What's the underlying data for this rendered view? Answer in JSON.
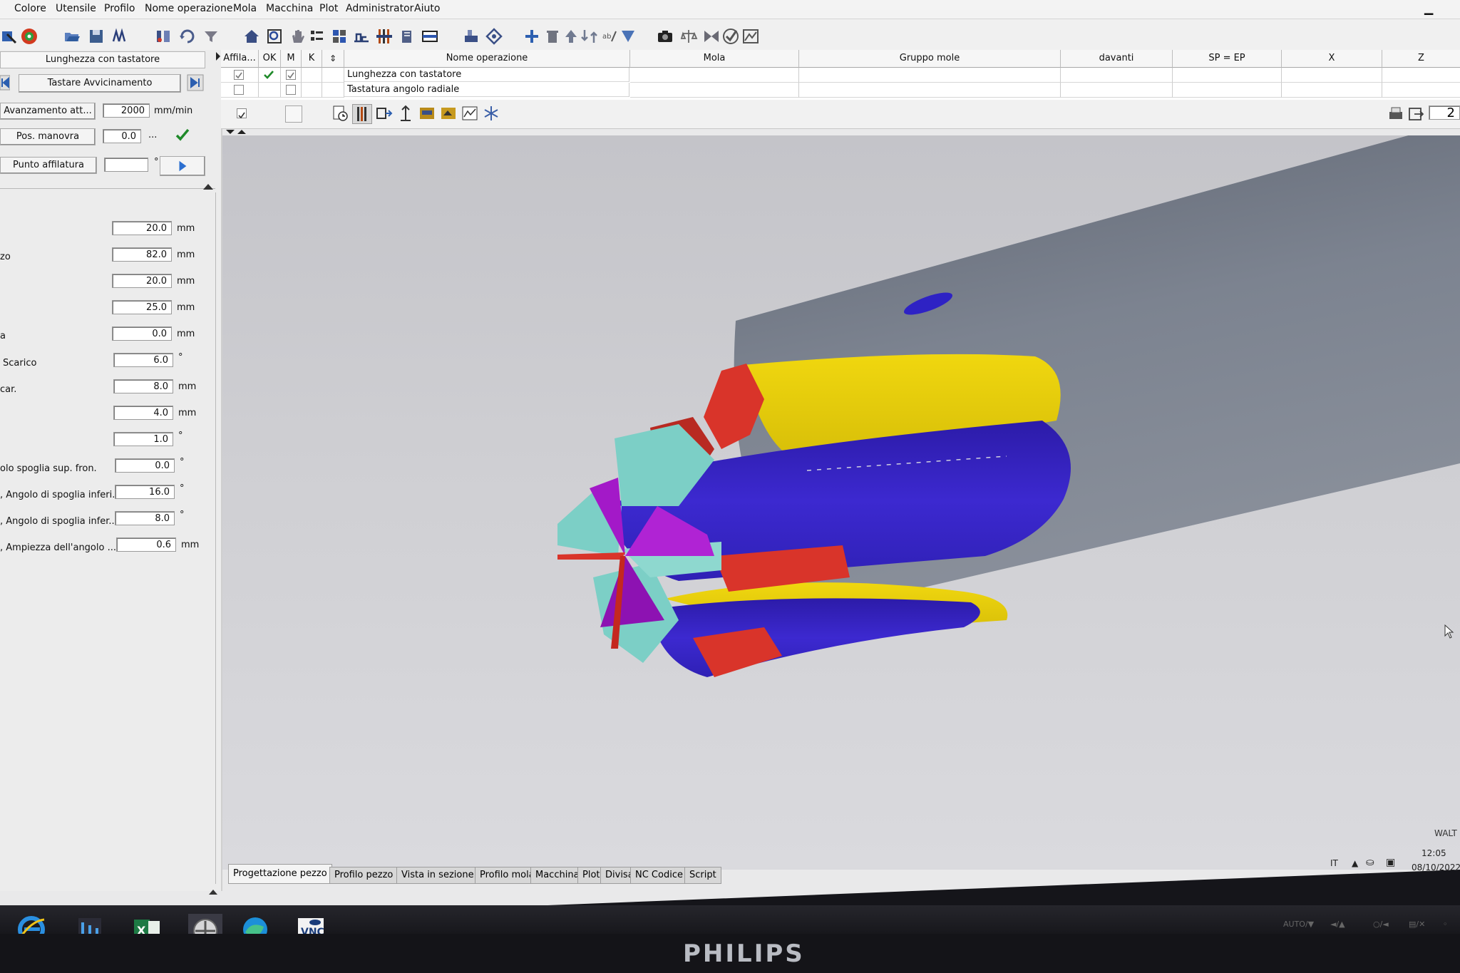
{
  "menu": {
    "items": [
      "Colore",
      "Utensile",
      "Profilo",
      "Nome operazione",
      "Mola",
      "Macchina",
      "Plot",
      "Administrator",
      "Aiuto"
    ]
  },
  "left_panel": {
    "operation_title": "Lunghezza con tastatore",
    "nav_label": "Tastare Avvicinamento",
    "advance_button": "Avanzamento att...",
    "advance_value": "2000",
    "advance_unit": "mm/min",
    "maneuver_button": "Pos. manovra",
    "maneuver_value": "0.0",
    "maneuver_ellipsis": "...",
    "sharpen_button": "Punto affilatura",
    "sharpen_unit": "°",
    "params": [
      {
        "label": "",
        "value": "20.0",
        "unit": "mm"
      },
      {
        "label": "zo",
        "value": "82.0",
        "unit": "mm"
      },
      {
        "label": "",
        "value": "20.0",
        "unit": "mm"
      },
      {
        "label": "",
        "value": "25.0",
        "unit": "mm"
      },
      {
        "label": "a",
        "value": "0.0",
        "unit": "mm"
      },
      {
        "label": "Scarico",
        "value": "6.0",
        "unit": "°"
      },
      {
        "label": "car.",
        "value": "8.0",
        "unit": "mm"
      },
      {
        "label": "",
        "value": "4.0",
        "unit": "mm"
      },
      {
        "label": "",
        "value": "1.0",
        "unit": "°"
      },
      {
        "label": "olo spoglia sup. fron.",
        "value": "0.0",
        "unit": "°"
      },
      {
        "label": ", Angolo di spoglia inferi...",
        "value": "16.0",
        "unit": "°"
      },
      {
        "label": ", Angolo di spoglia infer...",
        "value": "8.0",
        "unit": "°"
      },
      {
        "label": ", Ampiezza dell'angolo ...",
        "value": "0.6",
        "unit": "mm"
      }
    ]
  },
  "op_table": {
    "headers": {
      "affila": "Affila...",
      "ok": "OK",
      "m": "M",
      "k": "K",
      "nome": "Nome operazione",
      "mola": "Mola",
      "gruppo": "Gruppo mole",
      "davanti": "davanti",
      "spep": "SP = EP",
      "x": "X",
      "z": "Z"
    },
    "rows": [
      {
        "name": "Lunghezza con tastatore",
        "affila": true,
        "ok": true,
        "m": true
      },
      {
        "name": "Tastatura angolo radiale",
        "affila": false,
        "ok": false,
        "m": false
      }
    ]
  },
  "subbar_right_value": "2",
  "tabs": [
    "Progettazione pezzo",
    "Profilo pezzo",
    "Vista in sezione",
    "Profilo mola",
    "Macchina",
    "Plot",
    "Divisa",
    "NC Codice",
    "Script"
  ],
  "viewport_brand": "WALT",
  "tray": {
    "lang": "IT",
    "time": "12:05",
    "date": "08/10/2022"
  },
  "taskbar_icons": [
    "internet-explorer-icon",
    "tool-app-icon",
    "excel-icon",
    "app-circle-icon",
    "edge-icon",
    "vnc-icon"
  ],
  "monitor_brand": "PHILIPS",
  "bezel_labels": [
    "AUTO/▼",
    "◄/▲",
    "○/◄",
    "▤/✕",
    "◦"
  ],
  "colors": {
    "shank": "#757c87",
    "flute_yellow": "#e6cf10",
    "flute_blue": "#3a25c8",
    "face_cyan": "#7ccfc6",
    "face_red": "#d9342a",
    "face_magenta": "#a319c8",
    "accept_green": "#1f8a2a"
  }
}
